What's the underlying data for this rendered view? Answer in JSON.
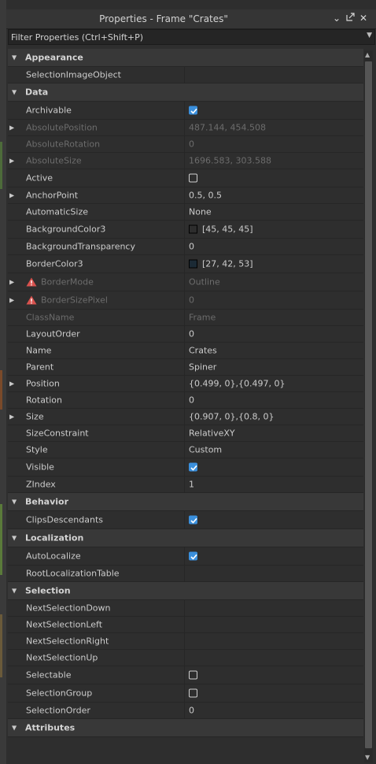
{
  "panel": {
    "title": "Properties - Frame \"Crates\""
  },
  "filter": {
    "placeholder": "Filter Properties (Ctrl+Shift+P)"
  },
  "colors": {
    "accent": "#3a8fdc",
    "warning": "#d9534f"
  },
  "rows": [
    {
      "kind": "section",
      "name": "Appearance"
    },
    {
      "kind": "prop",
      "name": "SelectionImageObject",
      "value": ""
    },
    {
      "kind": "section",
      "name": "Data"
    },
    {
      "kind": "prop",
      "name": "Archivable",
      "checkbox": true
    },
    {
      "kind": "prop",
      "name": "AbsolutePosition",
      "value": "487.144, 454.508",
      "dim": true,
      "expandable": true
    },
    {
      "kind": "prop",
      "name": "AbsoluteRotation",
      "value": "0",
      "dim": true
    },
    {
      "kind": "prop",
      "name": "AbsoluteSize",
      "value": "1696.583, 303.588",
      "dim": true,
      "expandable": true
    },
    {
      "kind": "prop",
      "name": "Active",
      "checkbox": false
    },
    {
      "kind": "prop",
      "name": "AnchorPoint",
      "value": "0.5, 0.5",
      "expandable": true
    },
    {
      "kind": "prop",
      "name": "AutomaticSize",
      "value": "None"
    },
    {
      "kind": "prop",
      "name": "BackgroundColor3",
      "value": "[45, 45, 45]",
      "swatch": "#2d2d2d"
    },
    {
      "kind": "prop",
      "name": "BackgroundTransparency",
      "value": "0"
    },
    {
      "kind": "prop",
      "name": "BorderColor3",
      "value": "[27, 42, 53]",
      "swatch": "#1b2a35"
    },
    {
      "kind": "prop",
      "name": "BorderMode",
      "value": "Outline",
      "dim": true,
      "warning": true,
      "expandable": true
    },
    {
      "kind": "prop",
      "name": "BorderSizePixel",
      "value": "0",
      "dim": true,
      "warning": true,
      "expandable": true
    },
    {
      "kind": "prop",
      "name": "ClassName",
      "value": "Frame",
      "dim": true
    },
    {
      "kind": "prop",
      "name": "LayoutOrder",
      "value": "0"
    },
    {
      "kind": "prop",
      "name": "Name",
      "value": "Crates"
    },
    {
      "kind": "prop",
      "name": "Parent",
      "value": "Spiner"
    },
    {
      "kind": "prop",
      "name": "Position",
      "value": "{0.499, 0},{0.497, 0}",
      "expandable": true
    },
    {
      "kind": "prop",
      "name": "Rotation",
      "value": "0"
    },
    {
      "kind": "prop",
      "name": "Size",
      "value": "{0.907, 0},{0.8, 0}",
      "expandable": true
    },
    {
      "kind": "prop",
      "name": "SizeConstraint",
      "value": "RelativeXY"
    },
    {
      "kind": "prop",
      "name": "Style",
      "value": "Custom"
    },
    {
      "kind": "prop",
      "name": "Visible",
      "checkbox": true
    },
    {
      "kind": "prop",
      "name": "ZIndex",
      "value": "1"
    },
    {
      "kind": "section",
      "name": "Behavior"
    },
    {
      "kind": "prop",
      "name": "ClipsDescendants",
      "checkbox": true
    },
    {
      "kind": "section",
      "name": "Localization"
    },
    {
      "kind": "prop",
      "name": "AutoLocalize",
      "checkbox": true
    },
    {
      "kind": "prop",
      "name": "RootLocalizationTable",
      "value": ""
    },
    {
      "kind": "section",
      "name": "Selection"
    },
    {
      "kind": "prop",
      "name": "NextSelectionDown",
      "value": ""
    },
    {
      "kind": "prop",
      "name": "NextSelectionLeft",
      "value": ""
    },
    {
      "kind": "prop",
      "name": "NextSelectionRight",
      "value": ""
    },
    {
      "kind": "prop",
      "name": "NextSelectionUp",
      "value": ""
    },
    {
      "kind": "prop",
      "name": "Selectable",
      "checkbox": false
    },
    {
      "kind": "prop",
      "name": "SelectionGroup",
      "checkbox": false
    },
    {
      "kind": "prop",
      "name": "SelectionOrder",
      "value": "0"
    },
    {
      "kind": "section",
      "name": "Attributes"
    }
  ]
}
